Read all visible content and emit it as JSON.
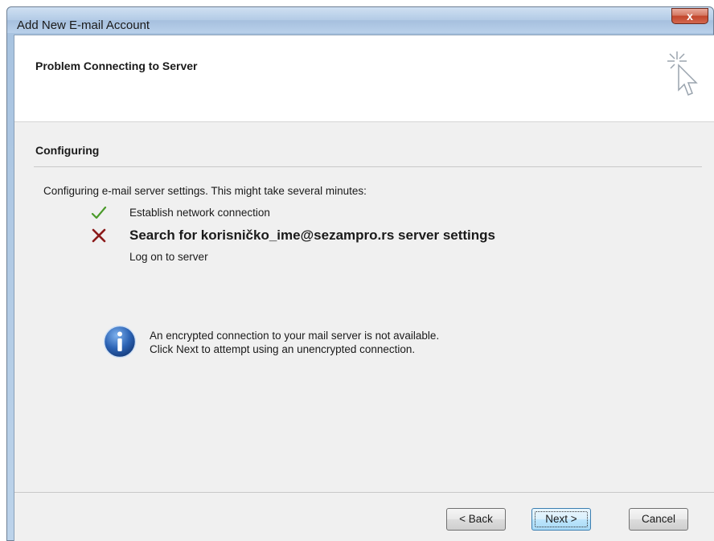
{
  "window": {
    "title": "Add New E-mail Account",
    "close_label": "x"
  },
  "header": {
    "title": "Problem Connecting to Server"
  },
  "section": {
    "title": "Configuring",
    "intro": "Configuring e-mail server settings. This might take several minutes:"
  },
  "steps": [
    {
      "label": "Establish network connection",
      "status": "success",
      "icon": "check-icon"
    },
    {
      "label": "Search for korisničko_ime@sezampro.rs server settings",
      "status": "failed",
      "icon": "x-icon"
    },
    {
      "label": "Log on to server",
      "status": "pending",
      "icon": ""
    }
  ],
  "info": {
    "line1": "An encrypted connection to your mail server is not available.",
    "line2": "Click Next to attempt using an unencrypted connection."
  },
  "buttons": {
    "back": "< Back",
    "next": "Next >",
    "cancel": "Cancel"
  },
  "colors": {
    "success": "#4a9a2a",
    "failure": "#8b1a1a",
    "info_blue": "#2d64b5"
  }
}
